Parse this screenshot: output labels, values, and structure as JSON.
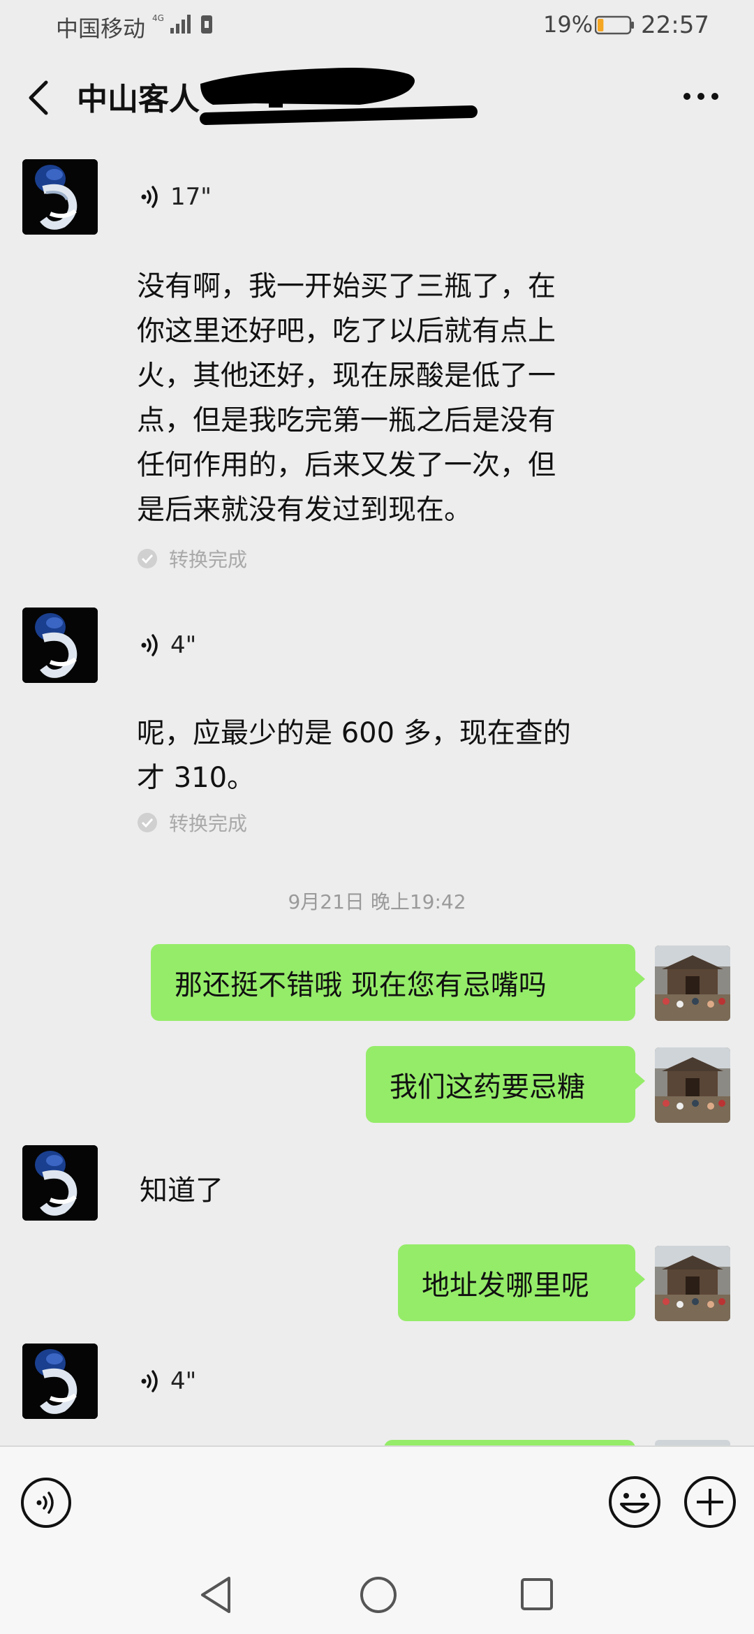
{
  "status_bar": {
    "carrier": "中国移动",
    "network": "4G",
    "battery_percent": "19%",
    "battery_level": 0.19,
    "time": "22:57"
  },
  "header": {
    "title": "中山客人"
  },
  "messages": {
    "m1": {
      "duration": "17\""
    },
    "m1_text": {
      "lines": [
        "没有啊，我一开始买了三瓶了，在",
        "你这里还好吧，吃了以后就有点上",
        "火，其他还好，现在尿酸是低了一",
        "点，但是我吃完第一瓶之后是没有",
        "任何作用的，后来又发了一次，但",
        "是后来就没有发过到现在。"
      ],
      "status": "转换完成"
    },
    "m2": {
      "duration": "4\""
    },
    "m2_text": {
      "lines": [
        "呢，应最少的是 600 多，现在查的",
        "才 310。"
      ],
      "status": "转换完成"
    },
    "timestamp": "9月21日 晚上19:42",
    "out1": "那还挺不错哦   现在您有忌嘴吗",
    "out2": "我们这药要忌糖",
    "in1": "知道了",
    "out3": "地址发哪里呢",
    "m3": {
      "duration": "4\""
    }
  },
  "icons": {
    "back": "chevron-left-icon",
    "more": "more-horizontal-icon",
    "voice_mode": "voice-icon",
    "emoji": "emoji-icon",
    "add": "plus-icon"
  },
  "colors": {
    "bubble_out": "#95ec69",
    "background": "#ededed",
    "battery_low": "#f5a623"
  }
}
